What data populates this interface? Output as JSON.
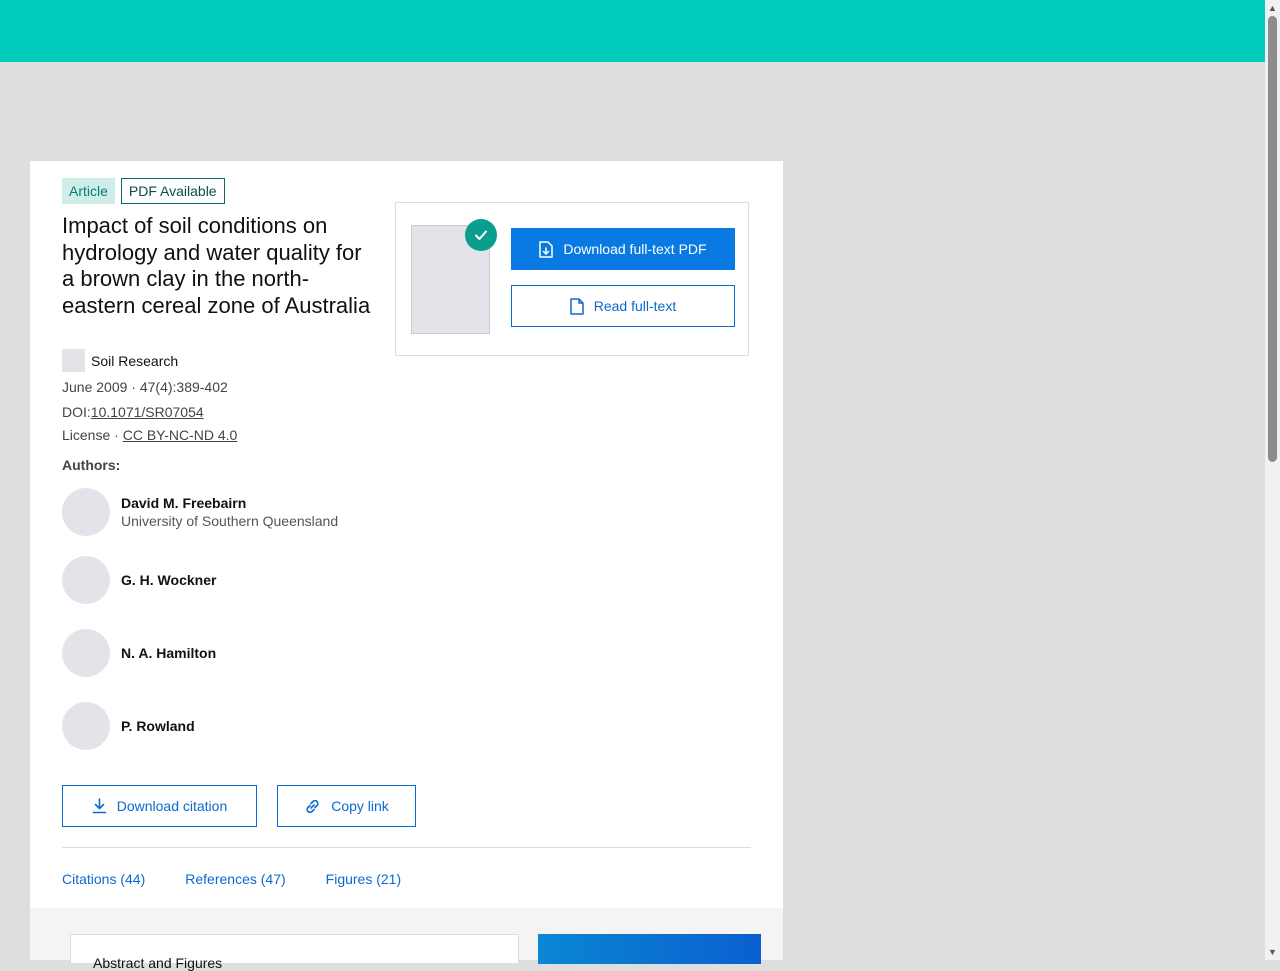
{
  "badges": {
    "article": "Article",
    "pdf": "PDF Available"
  },
  "title": "Impact of soil conditions on hydrology and water quality for a brown clay in the north-eastern cereal zone of Australia",
  "journal": "Soil Research",
  "date_pages": "June 2009 · 47(4):389-402",
  "doi_label": "DOI:",
  "doi": "10.1071/SR07054",
  "license_label": "License · ",
  "license": "CC BY-NC-ND 4.0",
  "authors_label": "Authors:",
  "authors": [
    {
      "name": "David M. Freebairn",
      "affiliation": "University of Southern Queensland"
    },
    {
      "name": "G. H. Wockner"
    },
    {
      "name": "N. A. Hamilton"
    },
    {
      "name": "P. Rowland"
    }
  ],
  "pdf_actions": {
    "download": "Download full-text PDF",
    "read": "Read full-text"
  },
  "actions": {
    "download_citation": "Download citation",
    "copy_link": "Copy link"
  },
  "tabs": [
    "Citations (44)",
    "References (47)",
    "Figures (21)"
  ],
  "lower_box_text": "Abstract and Figures",
  "colors": {
    "topbar": "#00ccbb",
    "primary": "#0a7ae3",
    "link": "#0a6ad0"
  }
}
